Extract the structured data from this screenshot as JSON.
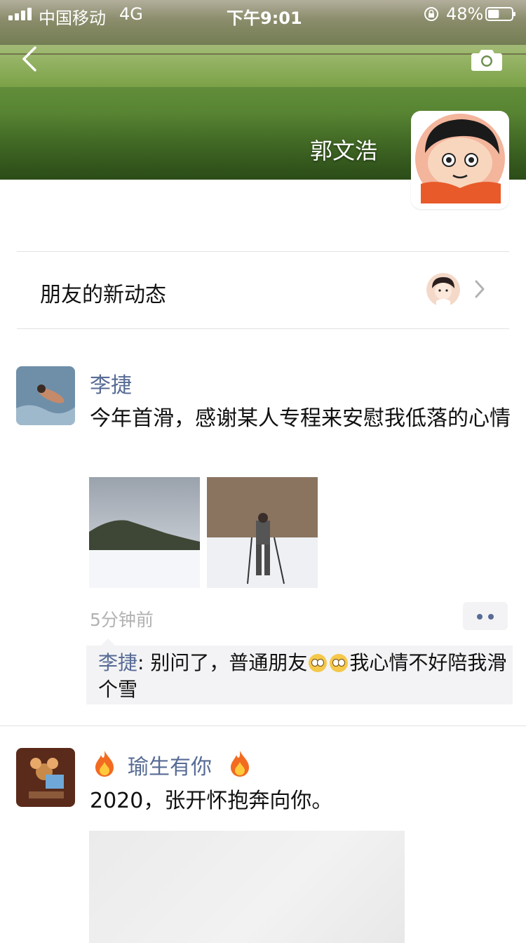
{
  "status_bar": {
    "carrier": "中国移动",
    "network": "4G",
    "time": "下午9:01",
    "battery_percent": "48%",
    "battery_level": 0.48
  },
  "header": {
    "profile_name": "郭文浩"
  },
  "new_updates": {
    "label": "朋友的新动态"
  },
  "posts": [
    {
      "author": "李捷",
      "text": "今年首滑，感谢某人专程来安慰我低落的心情",
      "images": [
        "mountain-snow-photo",
        "skier-photo"
      ],
      "time": "5分钟前",
      "comments": [
        {
          "author": "李捷",
          "separator": ":",
          "text_part1": " 别问了，普通朋友",
          "emojis": [
            "flushed-emoji",
            "flushed-emoji"
          ],
          "text_part2": "我心情不好陪我滑个雪"
        }
      ]
    },
    {
      "author": "瑜生有你",
      "text": "2020，张开怀抱奔向你。"
    }
  ],
  "colors": {
    "link_blue": "#576b95",
    "timestamp_gray": "#b2b2b2",
    "comment_bg": "#f3f3f5"
  }
}
